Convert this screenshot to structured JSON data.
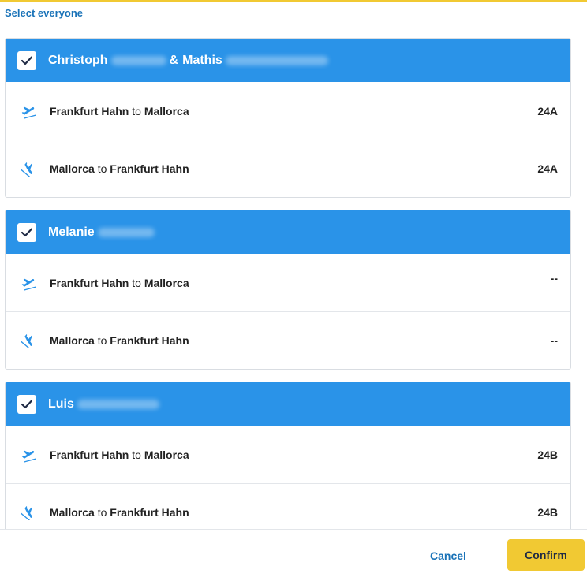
{
  "select_all_label": "Select everyone",
  "passengers": [
    {
      "first_name": "Christoph",
      "connector": "&",
      "second_name": "Mathis",
      "checked": true,
      "flights": [
        {
          "from": "Frankfurt Hahn",
          "to_word": "to",
          "to": "Mallorca",
          "seat": "24A"
        },
        {
          "from": "Mallorca",
          "to_word": "to",
          "to": "Frankfurt Hahn",
          "seat": "24A"
        }
      ]
    },
    {
      "first_name": "Melanie",
      "checked": true,
      "flights": [
        {
          "from": "Frankfurt Hahn",
          "to_word": "to",
          "to": "Mallorca",
          "seat": "--"
        },
        {
          "from": "Mallorca",
          "to_word": "to",
          "to": "Frankfurt Hahn",
          "seat": "--"
        }
      ]
    },
    {
      "first_name": "Luis",
      "checked": true,
      "flights": [
        {
          "from": "Frankfurt Hahn",
          "to_word": "to",
          "to": "Mallorca",
          "seat": "24B"
        },
        {
          "from": "Mallorca",
          "to_word": "to",
          "to": "Frankfurt Hahn",
          "seat": "24B"
        }
      ]
    }
  ],
  "footer": {
    "cancel_label": "Cancel",
    "confirm_label": "Confirm"
  },
  "colors": {
    "header_blue": "#2a93e8",
    "accent_yellow": "#f1c933",
    "link_blue": "#1a73b8",
    "checkmark_navy": "#1f2a44"
  },
  "icons": {
    "checkbox": "check-icon",
    "outbound": "plane-departure-icon",
    "return": "plane-return-icon"
  }
}
